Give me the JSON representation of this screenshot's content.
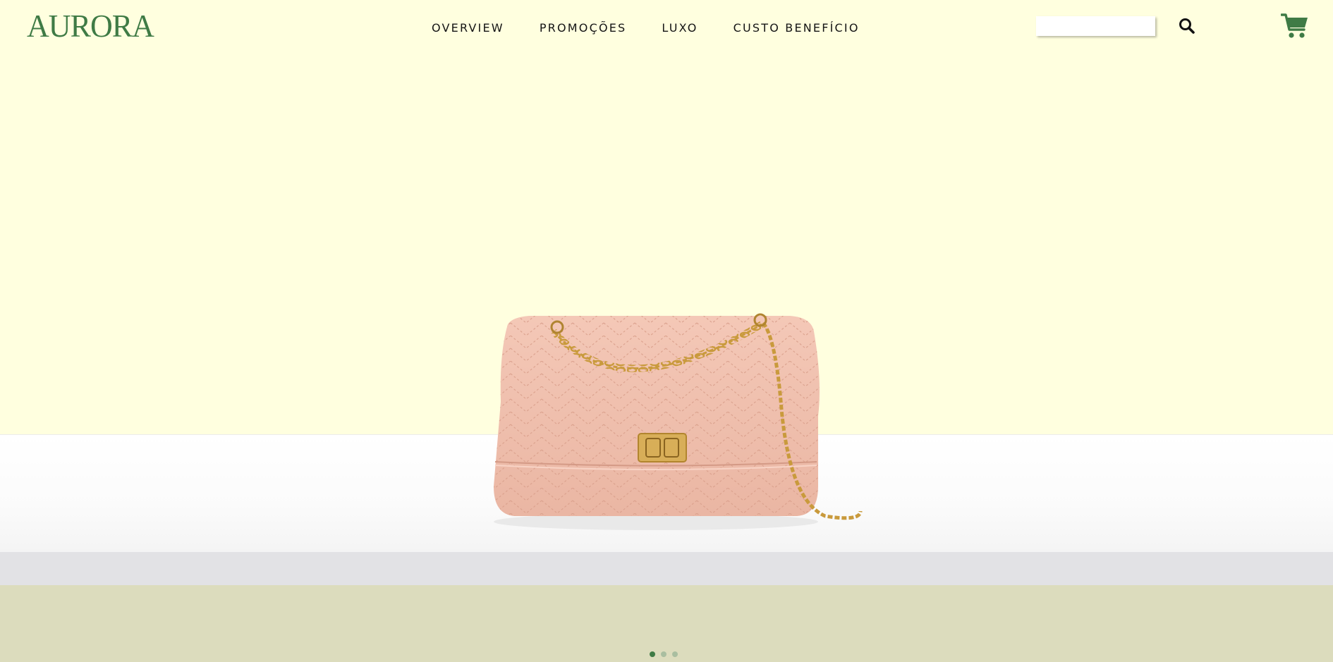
{
  "brand": {
    "name": "AURORA",
    "color": "#3f7b45"
  },
  "colors": {
    "hero_background": "#ffffdf",
    "floor": "#ffffff",
    "band_grey": "#e2e2e5",
    "band_olive": "#dcdcbd",
    "bag": "#f2c3b2",
    "hardware": "#c99a3c",
    "dot_active": "#3f7b45",
    "dot_inactive": "#a9bea0"
  },
  "nav": {
    "items": [
      {
        "label": "OVERVIEW"
      },
      {
        "label": "PROMOÇÕES"
      },
      {
        "label": "LUXO"
      },
      {
        "label": "CUSTO BENEFÍCIO"
      }
    ]
  },
  "search": {
    "placeholder": "",
    "value": "",
    "icon": "search-icon"
  },
  "cart": {
    "icon": "shopping-cart-icon"
  },
  "hero": {
    "product": "pink quilted chain-strap handbag"
  },
  "carousel": {
    "active_index": 0,
    "count": 3
  }
}
